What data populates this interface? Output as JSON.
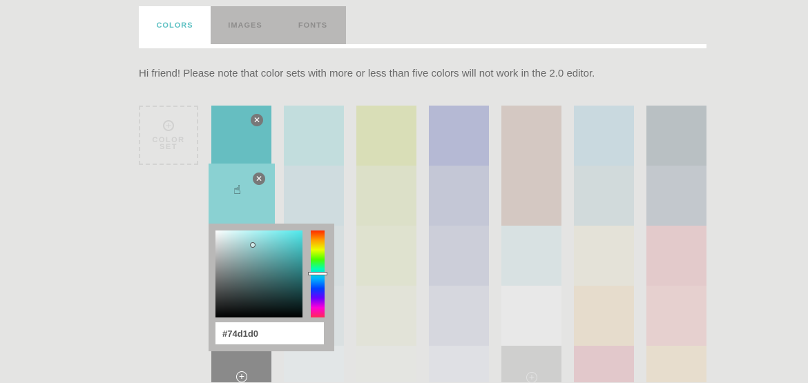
{
  "tabs": [
    {
      "label": "COLORS",
      "active": true
    },
    {
      "label": "IMAGES",
      "active": false
    },
    {
      "label": "FONTS",
      "active": false
    }
  ],
  "notice": "Hi friend! Please note that color sets with more or less than five colors will not work in the 2.0 editor.",
  "add_set": {
    "line1": "COLOR",
    "line2": "SET"
  },
  "colors": {
    "accent": "#5ec1c3",
    "selected_swatch_1": "#66bec1",
    "selected_swatch_2": "#8ad1d2",
    "disabled_add_tile": "#8a8a8a"
  },
  "close_glyph": "✕",
  "plus_glyph": "+",
  "picker": {
    "hex_value": "#74d1d0"
  },
  "cursor_icon": "hand-pointer"
}
